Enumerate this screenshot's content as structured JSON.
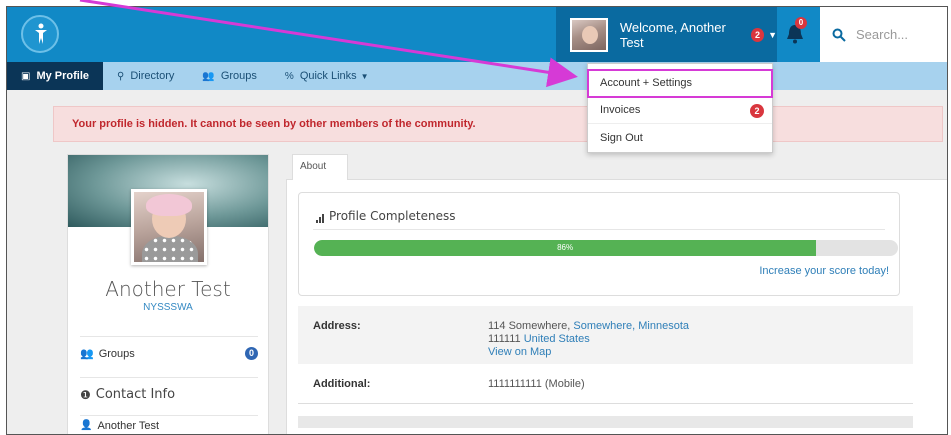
{
  "topbar": {
    "welcome_text": "Welcome, Another Test",
    "welcome_badge": "2",
    "bell_badge": "0",
    "search_placeholder": "Search..."
  },
  "nav": {
    "items": [
      {
        "label": "My Profile",
        "icon": "profile-icon",
        "active": true
      },
      {
        "label": "Directory",
        "icon": "search-icon",
        "active": false
      },
      {
        "label": "Groups",
        "icon": "groups-icon",
        "active": false
      },
      {
        "label": "Quick Links",
        "icon": "link-icon",
        "active": false
      }
    ]
  },
  "dropdown": {
    "items": [
      {
        "label": "Account + Settings",
        "highlighted": true
      },
      {
        "label": "Invoices",
        "badge": "2"
      },
      {
        "label": "Sign Out"
      }
    ]
  },
  "alert": {
    "text": "Your profile is hidden. It cannot be seen by other members of the community."
  },
  "profile": {
    "name": "Another Test",
    "org": "NYSSSWA",
    "groups_label": "Groups",
    "groups_count": "0",
    "contact_heading": "Contact Info",
    "contact_name": "Another Test"
  },
  "about": {
    "tab_label": "About",
    "completeness_title": "Profile Completeness",
    "progress_value": 86,
    "progress_label": "86%",
    "increase_link": "Increase your score today!",
    "address_label": "Address:",
    "address_line1_prefix": "114 Somewhere,",
    "address_city": "Somewhere,",
    "address_state": "Minnesota",
    "address_zip": "111111",
    "address_country": "United States",
    "map_link": "View on Map",
    "additional_label": "Additional:",
    "additional_value": "1111111111 (Mobile)"
  },
  "colors": {
    "topbar": "#1189c6",
    "welcome_bg": "#0a6aa0",
    "nav_bg": "#a7d2ee",
    "nav_active": "#0b3557",
    "alert_text": "#c0272d",
    "progress": "#55b254",
    "highlight": "#d63ad6"
  }
}
